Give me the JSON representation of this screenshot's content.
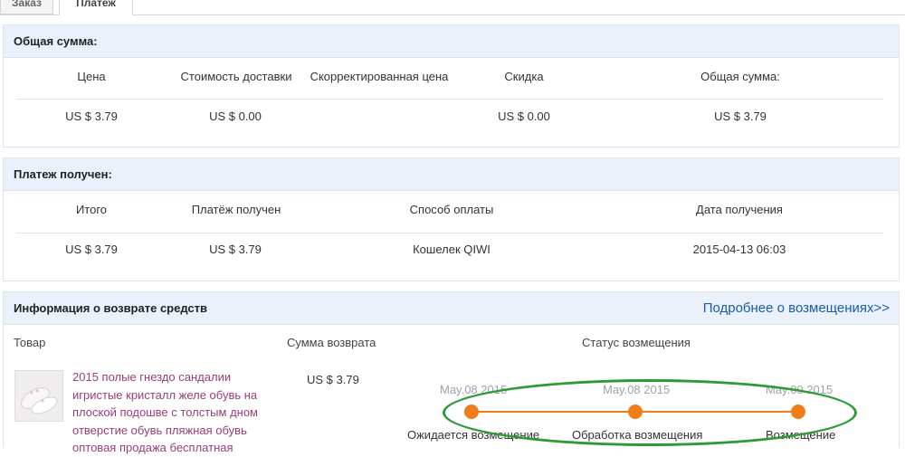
{
  "tabs": [
    {
      "label": "Заказ"
    },
    {
      "label": "Платеж"
    }
  ],
  "total": {
    "title": "Общая сумма:",
    "headers": [
      "Цена",
      "Стоимость доставки",
      "Скорректированная цена",
      "Скидка",
      "Общая сумма:"
    ],
    "values": [
      "US $ 3.79",
      "US $ 0.00",
      "",
      "US $ 0.00",
      "US $ 3.79"
    ]
  },
  "payment": {
    "title": "Платеж получен:",
    "headers": [
      "Итого",
      "Платёж получен",
      "Способ оплаты",
      "Дата получения"
    ],
    "values": [
      "US $ 3.79",
      "US $ 3.79",
      "Кошелек QIWI",
      "2015-04-13 06:03"
    ]
  },
  "refund": {
    "title": "Информация о возврате средств",
    "more_link": "Подробнее о возмещениях>>",
    "headers": [
      "Товар",
      "Сумма возврата",
      "Статус возмещения"
    ],
    "product_name": "2015 полые гнездо сандалии игристые кристалл желе обувь на плоской подошве с толстым дном отверстие обувь пляжная обувь оптовая продажа бесплатная",
    "amount": "US $ 3.79",
    "timeline": [
      {
        "date": "May.08 2015",
        "label": "Ожидается возмещение"
      },
      {
        "date": "May.08 2015",
        "label": "Обработка возмещения"
      },
      {
        "date": "May.09 2015",
        "label": "Возмещение"
      }
    ]
  },
  "colors": {
    "panel_header": "#eaf1fa",
    "link": "#1a5cae",
    "product_link": "#9b3d7a",
    "timeline": "#f07c1a",
    "annotation": "#2f9a35"
  }
}
